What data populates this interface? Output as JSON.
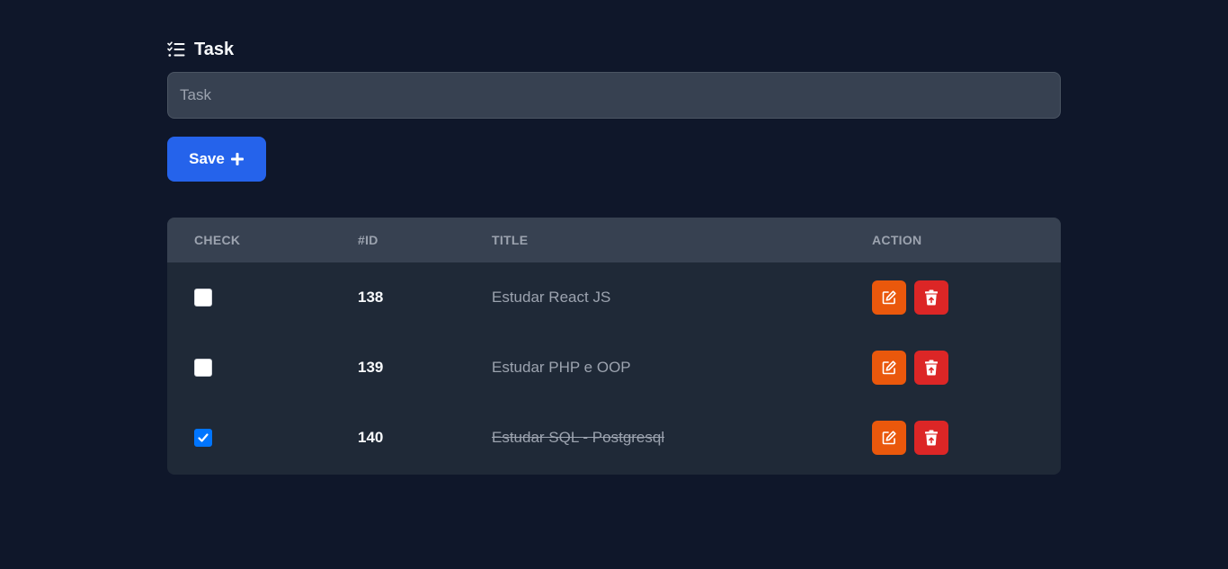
{
  "header": {
    "title": "Task",
    "icon": "list-check-icon"
  },
  "form": {
    "input_placeholder": "Task",
    "input_value": "",
    "save_label": "Save",
    "save_icon": "plus-icon"
  },
  "table": {
    "columns": [
      "CHECK",
      "#ID",
      "TITLE",
      "ACTION"
    ],
    "rows": [
      {
        "checked": false,
        "id": "138",
        "title": "Estudar React JS"
      },
      {
        "checked": false,
        "id": "139",
        "title": "Estudar PHP e OOP"
      },
      {
        "checked": true,
        "id": "140",
        "title": "Estudar SQL - Postgresql"
      }
    ]
  },
  "colors": {
    "background": "#0f172a",
    "primary": "#2563eb",
    "edit": "#ea580c",
    "delete": "#dc2626",
    "checked": "#0075ff"
  }
}
